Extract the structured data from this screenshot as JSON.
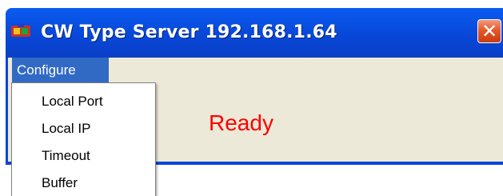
{
  "window": {
    "title": "CW Type Server 192.168.1.64",
    "close_label": "✕"
  },
  "menubar": {
    "configure_label": "Configure"
  },
  "status": {
    "text": "Ready",
    "color": "#ff0000"
  },
  "dropdown": {
    "items": [
      {
        "label": "Local Port"
      },
      {
        "label": "Local IP"
      },
      {
        "label": "Timeout"
      },
      {
        "label": "Buffer"
      }
    ]
  },
  "colors": {
    "title_bar": "#0a46d8",
    "menu_highlight": "#316ac5",
    "client_bg": "#ece9d8",
    "close_button": "#e35a2c"
  },
  "icons": {
    "app_icon": "app-icon",
    "close_icon": "close-icon"
  }
}
